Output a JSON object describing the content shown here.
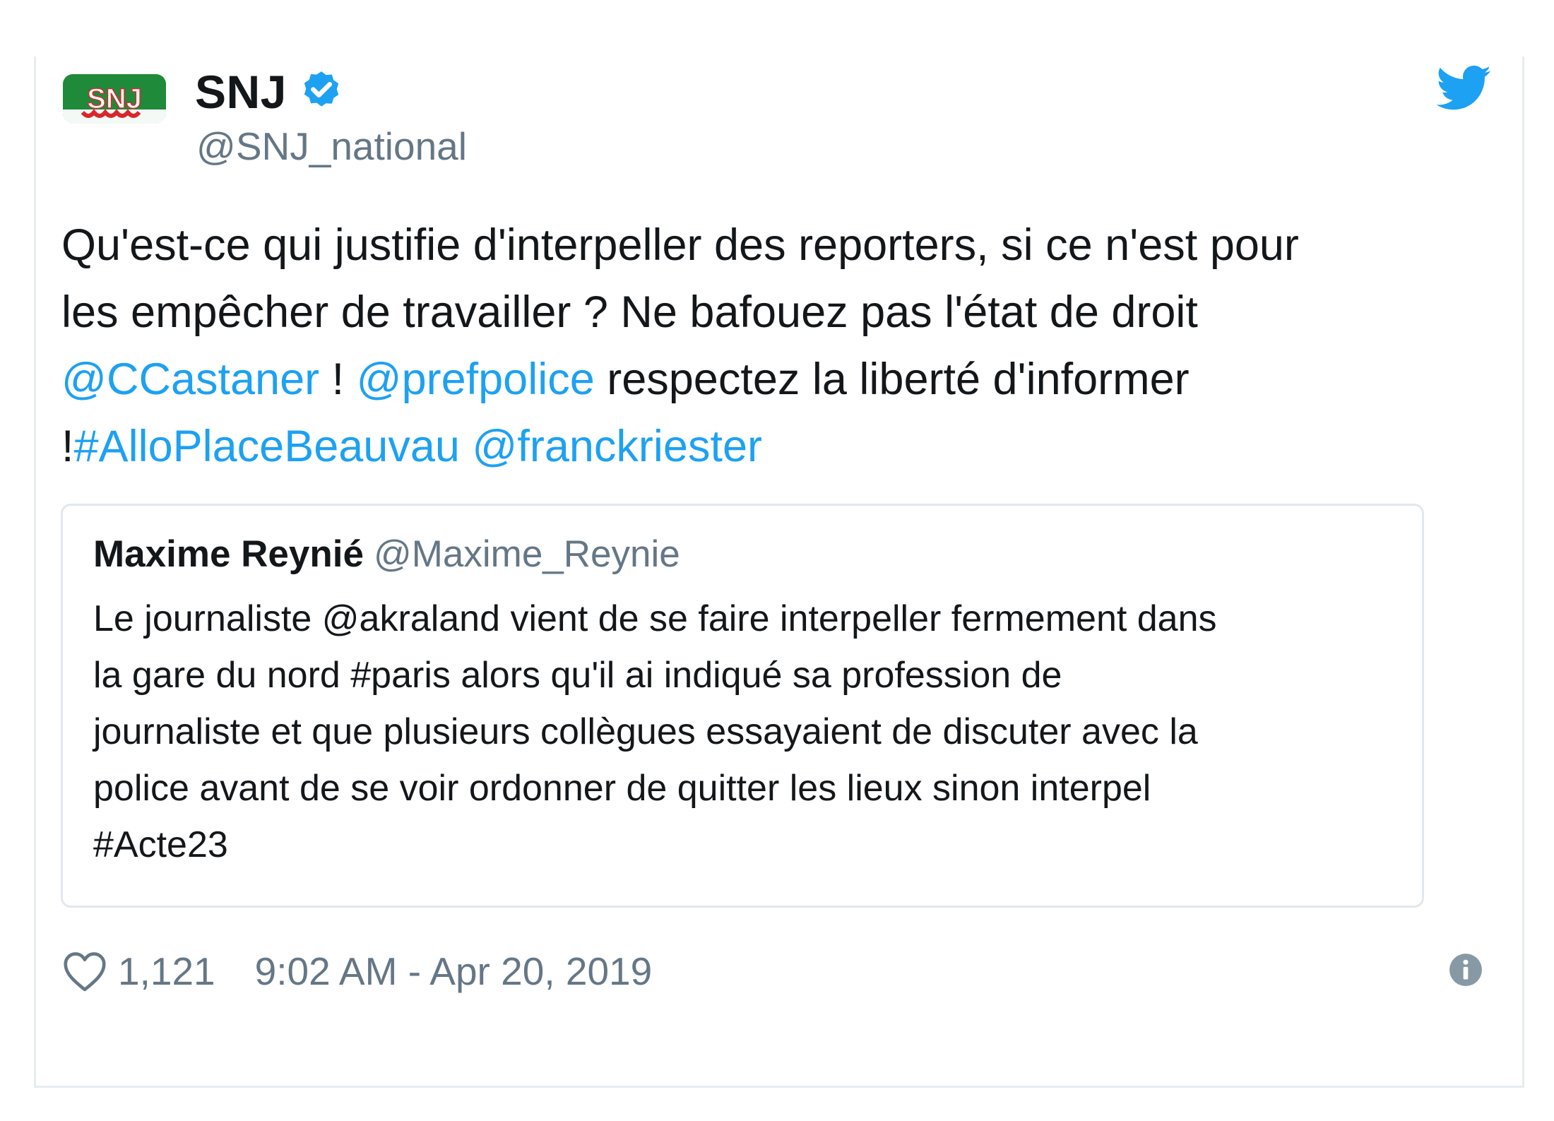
{
  "author": {
    "avatar_text": "SNJ",
    "display_name": "SNJ",
    "handle": "@SNJ_national",
    "verified": true
  },
  "icons": {
    "verified": "verified-badge-icon",
    "brand": "twitter-bird-icon",
    "like": "heart-icon",
    "info": "info-icon"
  },
  "colors": {
    "link": "#1da1f2",
    "text": "#14171a",
    "muted": "#657786",
    "avatar_green": "#1f8a3a",
    "avatar_red": "#d9262b"
  },
  "tweet": {
    "line1": "Qu'est-ce qui justifie d'interpeller des reporters, si ce n'est pour",
    "line2": "les empêcher de travailler ? Ne bafouez pas l'état de droit",
    "mention1": "@CCastaner",
    "sep1": " ! ",
    "mention2": "@prefpolice",
    "line3_tail": " respectez la liberté d'informer",
    "line4_head": "!",
    "hashtag": "#AlloPlaceBeauvau",
    "mention3": "@franckriester"
  },
  "quoted_tweet": {
    "display_name": "Maxime Reynié",
    "handle": "@Maxime_Reynie",
    "lines": [
      "Le journaliste @akraland vient de se faire interpeller fermement dans",
      "la gare du nord #paris alors qu'il ai indiqué sa profession de",
      "journaliste et que plusieurs collègues essayaient de discuter avec la",
      "police avant de se voir ordonner de quitter les lieux sinon interpel",
      "#Acte23"
    ]
  },
  "footer": {
    "likes": "1,121",
    "timestamp": "9:02 AM - Apr 20, 2019"
  }
}
